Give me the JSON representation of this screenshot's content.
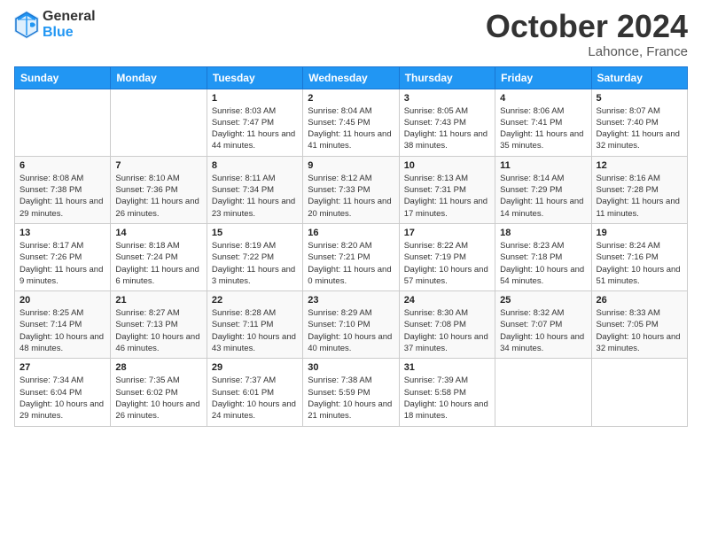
{
  "header": {
    "logo_general": "General",
    "logo_blue": "Blue",
    "month_title": "October 2024",
    "subtitle": "Lahonce, France"
  },
  "weekdays": [
    "Sunday",
    "Monday",
    "Tuesday",
    "Wednesday",
    "Thursday",
    "Friday",
    "Saturday"
  ],
  "weeks": [
    [
      {
        "day": "",
        "sunrise": "",
        "sunset": "",
        "daylight": ""
      },
      {
        "day": "",
        "sunrise": "",
        "sunset": "",
        "daylight": ""
      },
      {
        "day": "1",
        "sunrise": "Sunrise: 8:03 AM",
        "sunset": "Sunset: 7:47 PM",
        "daylight": "Daylight: 11 hours and 44 minutes."
      },
      {
        "day": "2",
        "sunrise": "Sunrise: 8:04 AM",
        "sunset": "Sunset: 7:45 PM",
        "daylight": "Daylight: 11 hours and 41 minutes."
      },
      {
        "day": "3",
        "sunrise": "Sunrise: 8:05 AM",
        "sunset": "Sunset: 7:43 PM",
        "daylight": "Daylight: 11 hours and 38 minutes."
      },
      {
        "day": "4",
        "sunrise": "Sunrise: 8:06 AM",
        "sunset": "Sunset: 7:41 PM",
        "daylight": "Daylight: 11 hours and 35 minutes."
      },
      {
        "day": "5",
        "sunrise": "Sunrise: 8:07 AM",
        "sunset": "Sunset: 7:40 PM",
        "daylight": "Daylight: 11 hours and 32 minutes."
      }
    ],
    [
      {
        "day": "6",
        "sunrise": "Sunrise: 8:08 AM",
        "sunset": "Sunset: 7:38 PM",
        "daylight": "Daylight: 11 hours and 29 minutes."
      },
      {
        "day": "7",
        "sunrise": "Sunrise: 8:10 AM",
        "sunset": "Sunset: 7:36 PM",
        "daylight": "Daylight: 11 hours and 26 minutes."
      },
      {
        "day": "8",
        "sunrise": "Sunrise: 8:11 AM",
        "sunset": "Sunset: 7:34 PM",
        "daylight": "Daylight: 11 hours and 23 minutes."
      },
      {
        "day": "9",
        "sunrise": "Sunrise: 8:12 AM",
        "sunset": "Sunset: 7:33 PM",
        "daylight": "Daylight: 11 hours and 20 minutes."
      },
      {
        "day": "10",
        "sunrise": "Sunrise: 8:13 AM",
        "sunset": "Sunset: 7:31 PM",
        "daylight": "Daylight: 11 hours and 17 minutes."
      },
      {
        "day": "11",
        "sunrise": "Sunrise: 8:14 AM",
        "sunset": "Sunset: 7:29 PM",
        "daylight": "Daylight: 11 hours and 14 minutes."
      },
      {
        "day": "12",
        "sunrise": "Sunrise: 8:16 AM",
        "sunset": "Sunset: 7:28 PM",
        "daylight": "Daylight: 11 hours and 11 minutes."
      }
    ],
    [
      {
        "day": "13",
        "sunrise": "Sunrise: 8:17 AM",
        "sunset": "Sunset: 7:26 PM",
        "daylight": "Daylight: 11 hours and 9 minutes."
      },
      {
        "day": "14",
        "sunrise": "Sunrise: 8:18 AM",
        "sunset": "Sunset: 7:24 PM",
        "daylight": "Daylight: 11 hours and 6 minutes."
      },
      {
        "day": "15",
        "sunrise": "Sunrise: 8:19 AM",
        "sunset": "Sunset: 7:22 PM",
        "daylight": "Daylight: 11 hours and 3 minutes."
      },
      {
        "day": "16",
        "sunrise": "Sunrise: 8:20 AM",
        "sunset": "Sunset: 7:21 PM",
        "daylight": "Daylight: 11 hours and 0 minutes."
      },
      {
        "day": "17",
        "sunrise": "Sunrise: 8:22 AM",
        "sunset": "Sunset: 7:19 PM",
        "daylight": "Daylight: 10 hours and 57 minutes."
      },
      {
        "day": "18",
        "sunrise": "Sunrise: 8:23 AM",
        "sunset": "Sunset: 7:18 PM",
        "daylight": "Daylight: 10 hours and 54 minutes."
      },
      {
        "day": "19",
        "sunrise": "Sunrise: 8:24 AM",
        "sunset": "Sunset: 7:16 PM",
        "daylight": "Daylight: 10 hours and 51 minutes."
      }
    ],
    [
      {
        "day": "20",
        "sunrise": "Sunrise: 8:25 AM",
        "sunset": "Sunset: 7:14 PM",
        "daylight": "Daylight: 10 hours and 48 minutes."
      },
      {
        "day": "21",
        "sunrise": "Sunrise: 8:27 AM",
        "sunset": "Sunset: 7:13 PM",
        "daylight": "Daylight: 10 hours and 46 minutes."
      },
      {
        "day": "22",
        "sunrise": "Sunrise: 8:28 AM",
        "sunset": "Sunset: 7:11 PM",
        "daylight": "Daylight: 10 hours and 43 minutes."
      },
      {
        "day": "23",
        "sunrise": "Sunrise: 8:29 AM",
        "sunset": "Sunset: 7:10 PM",
        "daylight": "Daylight: 10 hours and 40 minutes."
      },
      {
        "day": "24",
        "sunrise": "Sunrise: 8:30 AM",
        "sunset": "Sunset: 7:08 PM",
        "daylight": "Daylight: 10 hours and 37 minutes."
      },
      {
        "day": "25",
        "sunrise": "Sunrise: 8:32 AM",
        "sunset": "Sunset: 7:07 PM",
        "daylight": "Daylight: 10 hours and 34 minutes."
      },
      {
        "day": "26",
        "sunrise": "Sunrise: 8:33 AM",
        "sunset": "Sunset: 7:05 PM",
        "daylight": "Daylight: 10 hours and 32 minutes."
      }
    ],
    [
      {
        "day": "27",
        "sunrise": "Sunrise: 7:34 AM",
        "sunset": "Sunset: 6:04 PM",
        "daylight": "Daylight: 10 hours and 29 minutes."
      },
      {
        "day": "28",
        "sunrise": "Sunrise: 7:35 AM",
        "sunset": "Sunset: 6:02 PM",
        "daylight": "Daylight: 10 hours and 26 minutes."
      },
      {
        "day": "29",
        "sunrise": "Sunrise: 7:37 AM",
        "sunset": "Sunset: 6:01 PM",
        "daylight": "Daylight: 10 hours and 24 minutes."
      },
      {
        "day": "30",
        "sunrise": "Sunrise: 7:38 AM",
        "sunset": "Sunset: 5:59 PM",
        "daylight": "Daylight: 10 hours and 21 minutes."
      },
      {
        "day": "31",
        "sunrise": "Sunrise: 7:39 AM",
        "sunset": "Sunset: 5:58 PM",
        "daylight": "Daylight: 10 hours and 18 minutes."
      },
      {
        "day": "",
        "sunrise": "",
        "sunset": "",
        "daylight": ""
      },
      {
        "day": "",
        "sunrise": "",
        "sunset": "",
        "daylight": ""
      }
    ]
  ]
}
